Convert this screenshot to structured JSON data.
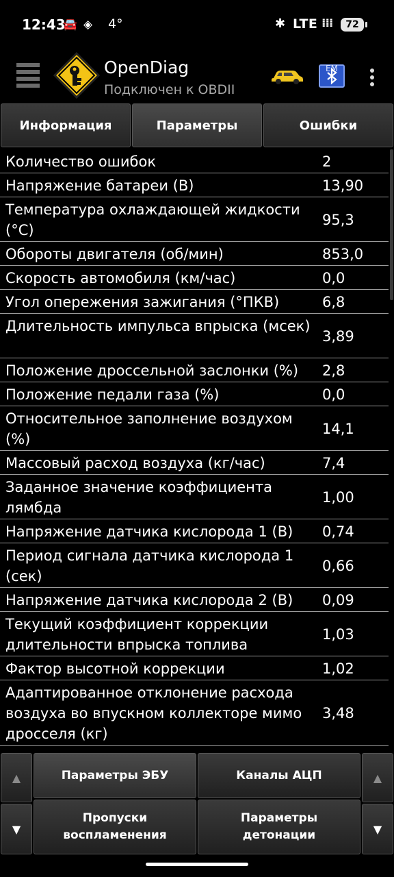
{
  "status_bar": {
    "time": "12:43",
    "temperature": "4°",
    "network": "LTE",
    "battery": "72"
  },
  "app_bar": {
    "title": "OpenDiag",
    "subtitle": "Подключен к OBDII",
    "bt_badge": "EM"
  },
  "tabs": [
    {
      "label": "Информация"
    },
    {
      "label": "Параметры"
    },
    {
      "label": "Ошибки"
    }
  ],
  "parameters": [
    {
      "name": "Количество ошибок",
      "value": "2"
    },
    {
      "name": "Напряжение батареи (В)",
      "value": "13,90"
    },
    {
      "name": "Температура охлаждающей жидкости (°C)",
      "value": "95,3"
    },
    {
      "name": "Обороты двигателя (об/мин)",
      "value": "853,0"
    },
    {
      "name": "Скорость автомобиля (км/час)",
      "value": "0,0"
    },
    {
      "name": "Угол опережения зажигания (°ПКВ)",
      "value": "6,8"
    },
    {
      "name": "Длительность импульса впрыска (мсек)",
      "value": "3,89"
    },
    {
      "name": "Положение дроссельной заслонки (%)",
      "value": "2,8"
    },
    {
      "name": "Положение педали газа (%)",
      "value": "0,0"
    },
    {
      "name": "Относительное заполнение воздухом (%)",
      "value": "14,1"
    },
    {
      "name": "Массовый расход воздуха (кг/час)",
      "value": "7,4"
    },
    {
      "name": "Заданное значение коэффициента лямбда",
      "value": "1,00"
    },
    {
      "name": "Напряжение датчика кислорода 1 (В)",
      "value": "0,74"
    },
    {
      "name": "Период сигнала датчика кислорода 1 (сек)",
      "value": "0,66"
    },
    {
      "name": "Напряжение датчика кислорода 2 (В)",
      "value": "0,09"
    },
    {
      "name": "Текущий коэффициент коррекции длительности впрыска топлива",
      "value": "1,03"
    },
    {
      "name": "Фактор высотной коррекции",
      "value": "1,02"
    },
    {
      "name": "Адаптированное отклонение расхода воздуха во впускном коллекторе мимо дросселя (кг)",
      "value": "3,48"
    }
  ],
  "bottom_buttons": {
    "ecu_params": "Параметры ЭБУ",
    "adc_channels": "Каналы АЦП",
    "misfires": "Пропуски\nвоспламенения",
    "knock_params": "Параметры\nдетонации",
    "up_arrow": "▲",
    "down_arrow": "▼"
  }
}
